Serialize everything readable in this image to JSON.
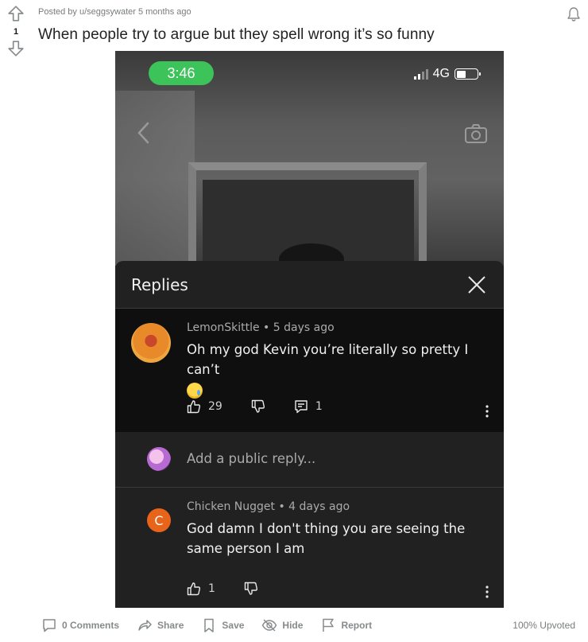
{
  "post": {
    "meta": "Posted by u/seggsywater 5 months ago",
    "title": "When people try to argue but they spell wrong it’s so funny",
    "vote_count": "1"
  },
  "phone": {
    "time": "3:46",
    "network": "4G"
  },
  "sheet": {
    "title": "Replies",
    "comments": [
      {
        "author_line": "LemonSkittle • 5 days ago",
        "text": "Oh my god Kevin you’re literally so pretty I can’t",
        "likes": "29",
        "replies": "1"
      },
      {
        "avatar_letter": "C",
        "author_line": "Chicken Nugget • 4 days ago",
        "text": "God damn I don't thing you are seeing the same person I am",
        "likes": "1"
      }
    ],
    "reply_placeholder": "Add a public reply..."
  },
  "footer": {
    "comments": "0 Comments",
    "share": "Share",
    "save": "Save",
    "hide": "Hide",
    "report": "Report",
    "upvoted": "100% Upvoted"
  },
  "colors": {
    "time_pill": "#3cc35a",
    "nugget_avatar": "#e8641b",
    "sheet_bg": "#212121",
    "highlight_bg": "#0f0f0f"
  }
}
